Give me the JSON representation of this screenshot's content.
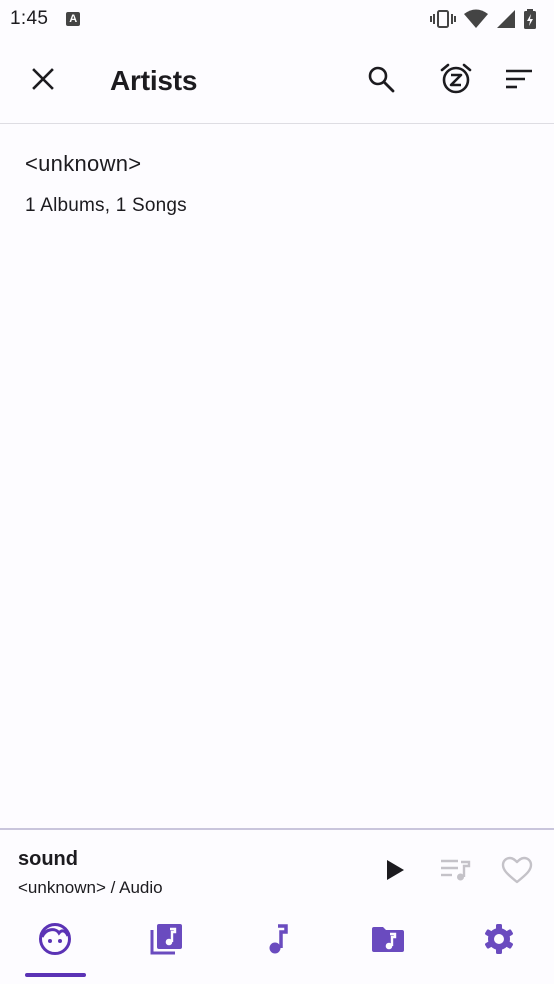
{
  "status_bar": {
    "time": "1:45",
    "notification_letter": "A"
  },
  "app_bar": {
    "title": "Artists",
    "icons": {
      "close": "close-icon",
      "search": "search-icon",
      "sleep_timer": "sleep-timer-icon",
      "sort": "sort-icon"
    }
  },
  "artists": [
    {
      "name": "<unknown>",
      "albums": "1 Albums,",
      "songs": "1 Songs"
    }
  ],
  "player": {
    "title": "sound",
    "subtitle": "<unknown> / Audio"
  },
  "bottom_nav": {
    "items": [
      "artists",
      "albums",
      "songs",
      "folders",
      "settings"
    ],
    "selected": "artists"
  },
  "colors": {
    "accent": "#5b33b5",
    "nav_icon": "#6a4bbf",
    "background": "#fdfcff",
    "divider": "#dedde3",
    "player_border": "#c9c5dc"
  }
}
